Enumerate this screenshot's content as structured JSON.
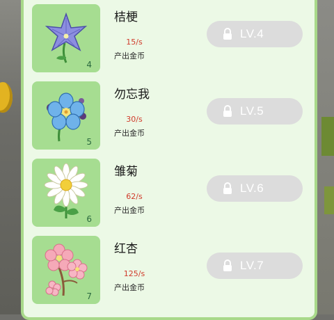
{
  "colors": {
    "panel_bg": "#ecf9e6",
    "tile_bg": "#a6dd91",
    "rate_text": "#d03a2a",
    "locked_button": "#dcdcdc"
  },
  "output_label": "产出金币",
  "flowers": [
    {
      "name": "桔梗",
      "rate": "15/s",
      "level": "4",
      "button_label": "LV.4",
      "locked": true,
      "icon": "bellflower-icon"
    },
    {
      "name": "勿忘我",
      "rate": "30/s",
      "level": "5",
      "button_label": "LV.5",
      "locked": true,
      "icon": "forget-me-not-icon"
    },
    {
      "name": "雏菊",
      "rate": "62/s",
      "level": "6",
      "button_label": "LV.6",
      "locked": true,
      "icon": "daisy-icon"
    },
    {
      "name": "红杏",
      "rate": "125/s",
      "level": "7",
      "button_label": "LV.7",
      "locked": true,
      "icon": "apricot-blossom-icon"
    }
  ]
}
